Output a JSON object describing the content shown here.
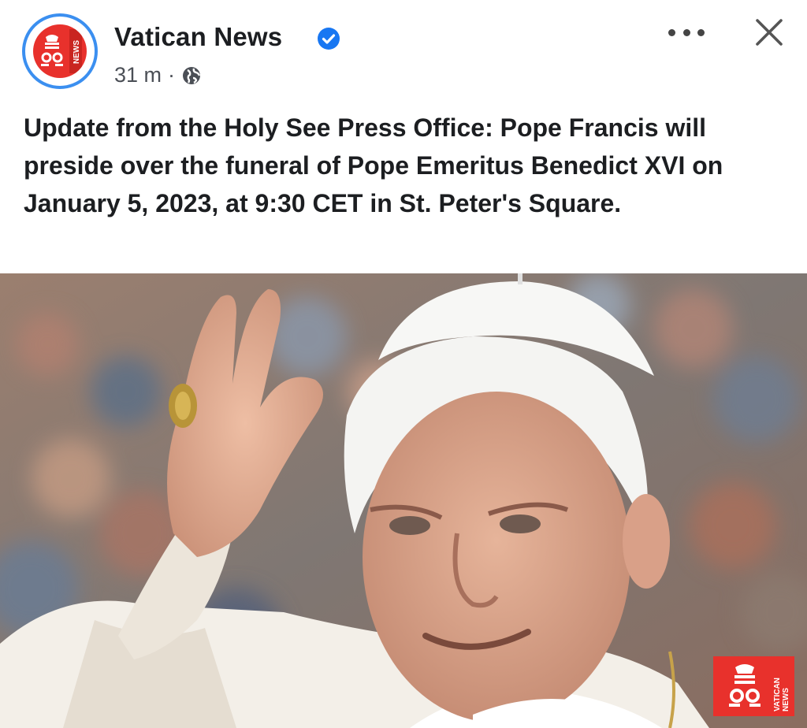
{
  "post": {
    "page_name": "Vatican News",
    "verified": true,
    "time": "31 m",
    "separator": "·",
    "audience_icon": "globe-icon",
    "text": "Update from the Holy See Press Office: Pope Francis will preside over the funeral of Pope Emeritus Benedict XVI on January 5, 2023, at 9:30 CET in St. Peter's Square."
  },
  "avatar": {
    "logo_text": "NEWS"
  },
  "header_actions": {
    "more_icon": "more-icon",
    "close_icon": "close-icon"
  },
  "photo": {
    "watermark": {
      "line1": "VATICAN",
      "line2": "NEWS"
    }
  },
  "colors": {
    "verified_blue": "#1877f2",
    "avatar_ring": "#3b8ff0",
    "brand_red": "#e8312c"
  }
}
